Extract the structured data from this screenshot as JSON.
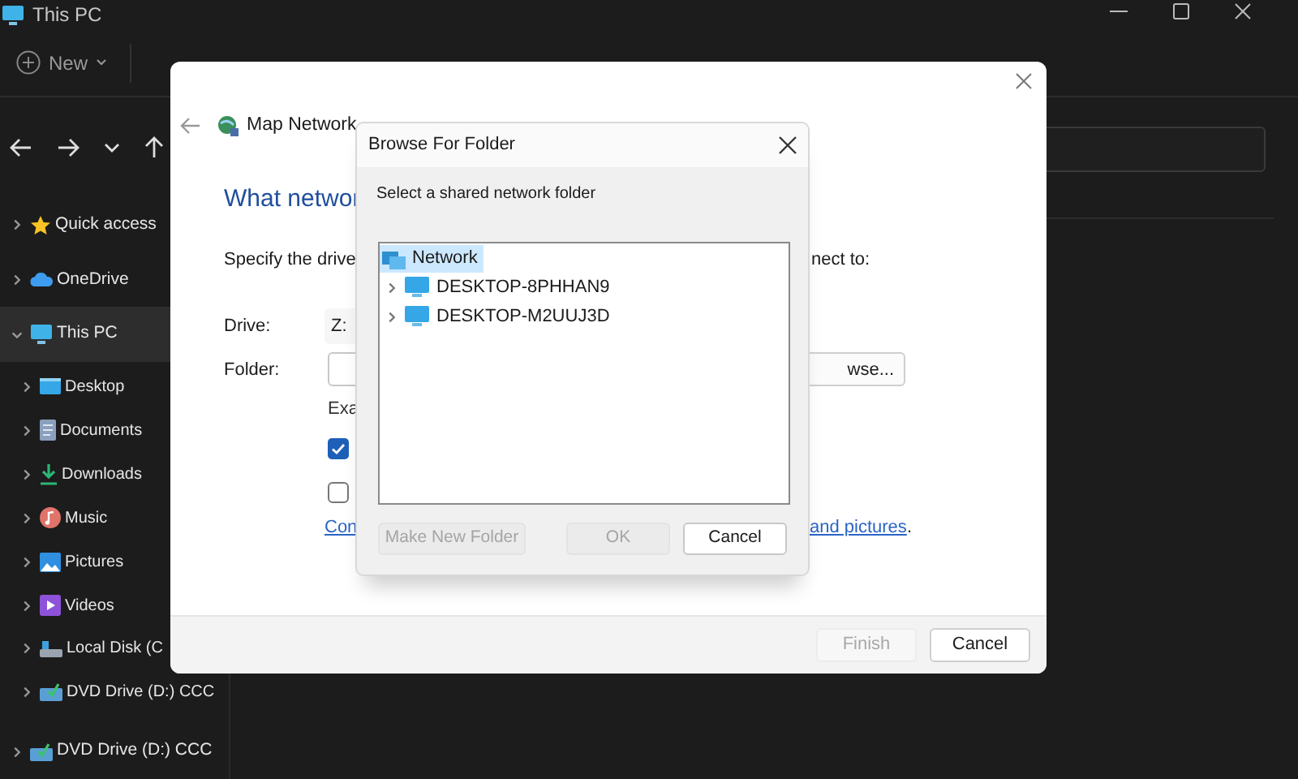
{
  "explorer": {
    "title": "This PC",
    "new_button": "New",
    "sidebar": [
      {
        "kind": "star",
        "label": "Quick access",
        "expanded": false,
        "selected": false
      },
      {
        "kind": "cloud",
        "label": "OneDrive",
        "expanded": false,
        "selected": false
      },
      {
        "kind": "pc",
        "label": "This PC",
        "expanded": true,
        "selected": true,
        "children": [
          {
            "kind": "desktop",
            "label": "Desktop",
            "expanded": false,
            "selected": false
          },
          {
            "kind": "documents",
            "label": "Documents",
            "expanded": false,
            "selected": false
          },
          {
            "kind": "downloads",
            "label": "Downloads",
            "expanded": false,
            "selected": false
          },
          {
            "kind": "music",
            "label": "Music",
            "expanded": false,
            "selected": false
          },
          {
            "kind": "pictures",
            "label": "Pictures",
            "expanded": false,
            "selected": false
          },
          {
            "kind": "videos",
            "label": "Videos",
            "expanded": false,
            "selected": false
          },
          {
            "kind": "disk",
            "label": "Local Disk (C",
            "expanded": false,
            "selected": false
          },
          {
            "kind": "dvd",
            "label": "DVD Drive (D:) CCC",
            "expanded": false,
            "selected": false
          }
        ]
      },
      {
        "kind": "dvd",
        "label": "DVD Drive (D:) CCC",
        "expanded": false,
        "selected": false
      }
    ]
  },
  "map_drive": {
    "title": "Map Network",
    "heading": "What networ",
    "instruction_left": "Specify the drive",
    "instruction_right": "nect to:",
    "drive_label": "Drive:",
    "drive_value": "Z:",
    "folder_label": "Folder:",
    "browse_button": "wse...",
    "example": "Exa",
    "checkboxes": [
      {
        "checked": true
      },
      {
        "checked": false
      }
    ],
    "link_left": "Con",
    "link_right": "and pictures",
    "link_suffix": ".",
    "buttons": [
      {
        "label": "Finish",
        "disabled": true
      },
      {
        "label": "Cancel",
        "disabled": false
      }
    ]
  },
  "browse": {
    "title": "Browse For Folder",
    "prompt": "Select a shared network folder",
    "tree": [
      {
        "label": "Network",
        "selected": true,
        "children": [
          {
            "label": "DESKTOP-8PHHAN9",
            "selected": false,
            "expanded": false
          },
          {
            "label": "DESKTOP-M2UUJ3D",
            "selected": false,
            "expanded": false
          }
        ]
      }
    ],
    "buttons": [
      {
        "label": "Make New Folder",
        "disabled": true
      },
      {
        "label": "OK",
        "disabled": true
      },
      {
        "label": "Cancel",
        "disabled": false
      }
    ]
  }
}
